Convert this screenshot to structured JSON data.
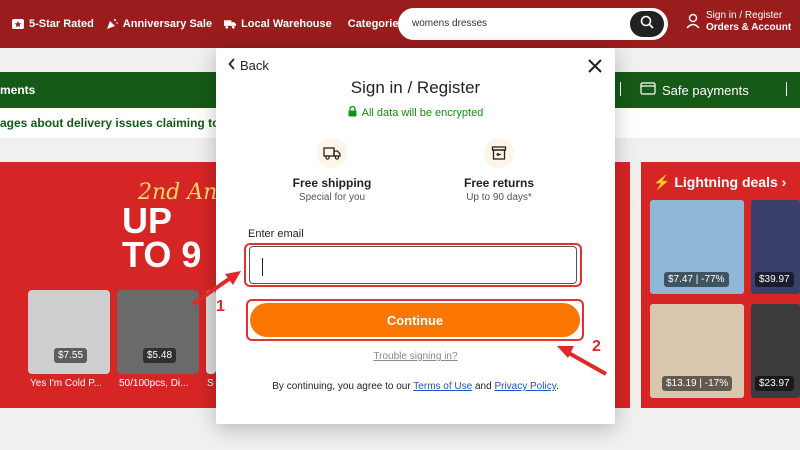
{
  "header": {
    "items": [
      {
        "label": "5-Star Rated",
        "icon": "star-icon"
      },
      {
        "label": "Anniversary Sale",
        "icon": "party-icon"
      },
      {
        "label": "Local Warehouse",
        "icon": "truck-icon"
      }
    ],
    "categories_label": "Categories",
    "search": {
      "value": "womens dresses",
      "icon": "search-icon"
    },
    "account": {
      "line1": "Sign in / Register",
      "line2": "Orders & Account",
      "icon": "user-icon"
    }
  },
  "greenbar": {
    "left_text": "ments",
    "right_text": "Safe payments"
  },
  "notice": {
    "text": "ages about delivery issues claiming to"
  },
  "banner": {
    "title_line1": "2nd An",
    "title_line2": "UP",
    "title_line3": "TO 9",
    "products": [
      {
        "price": "$7.55",
        "label": "Yes I'm Cold P..."
      },
      {
        "price": "$5.48",
        "label": "50/100pcs, Di..."
      },
      {
        "price": "",
        "label": "S"
      }
    ]
  },
  "deals": {
    "heading": "Lightning deals",
    "items": [
      {
        "price": "$7.47 | -77%"
      },
      {
        "price": "$39.97"
      },
      {
        "price": "$13.19 | -17%"
      },
      {
        "price": "$23.97"
      }
    ]
  },
  "modal": {
    "back_label": "Back",
    "title": "Sign in / Register",
    "encrypted_text": "All data will be encrypted",
    "benefits": [
      {
        "title": "Free shipping",
        "subtitle": "Special for you",
        "icon": "truck-icon"
      },
      {
        "title": "Free returns",
        "subtitle": "Up to 90 days*",
        "icon": "return-box-icon"
      }
    ],
    "email_label": "Enter email",
    "email_value": "",
    "continue_label": "Continue",
    "trouble_link": "Trouble signing in?",
    "terms_prefix": "By continuing, you agree to our",
    "terms_link": "Terms of Use",
    "terms_and": "and",
    "privacy_link": "Privacy Policy",
    "terms_suffix": "."
  },
  "annotations": [
    {
      "number": "1"
    },
    {
      "number": "2"
    }
  ],
  "colors": {
    "header": "#9a1d1d",
    "accent_orange": "#fb7701",
    "secure_green": "#109410",
    "annotation_red": "#e02a2a"
  }
}
